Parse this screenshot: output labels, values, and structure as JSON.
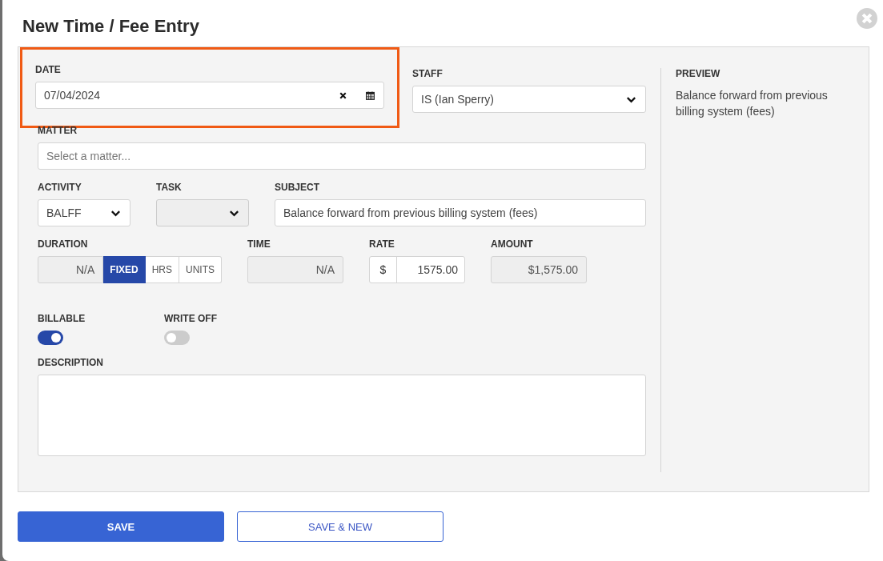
{
  "dialog": {
    "title": "New Time / Fee Entry"
  },
  "date": {
    "label": "DATE",
    "value": "07/04/2024",
    "highlighted": true
  },
  "staff": {
    "label": "STAFF",
    "value": "IS (Ian Sperry)"
  },
  "matter": {
    "label": "MATTER",
    "placeholder": "Select a matter..."
  },
  "activity": {
    "label": "ACTIVITY",
    "value": "BALFF"
  },
  "task": {
    "label": "TASK",
    "disabled": true
  },
  "subject": {
    "label": "SUBJECT",
    "value": "Balance forward from previous billing system (fees)"
  },
  "duration": {
    "label": "DURATION",
    "value": "N/A",
    "modes": [
      {
        "label": "FIXED",
        "selected": true
      },
      {
        "label": "HRS",
        "selected": false
      },
      {
        "label": "UNITS",
        "selected": false
      }
    ]
  },
  "time": {
    "label": "TIME",
    "value": "N/A"
  },
  "rate": {
    "label": "RATE",
    "prefix": "$",
    "value": "1575.00"
  },
  "amount": {
    "label": "AMOUNT",
    "value": "$1,575.00"
  },
  "toggles": [
    {
      "label": "BILLABLE",
      "on": true
    },
    {
      "label": "WRITE OFF",
      "on": false
    }
  ],
  "description": {
    "label": "DESCRIPTION"
  },
  "preview": {
    "label": "PREVIEW",
    "text": "Balance forward from previous billing system (fees)"
  },
  "buttons": [
    {
      "label": "SAVE",
      "kind": "primary"
    },
    {
      "label": "SAVE & NEW",
      "kind": "secondary"
    }
  ]
}
